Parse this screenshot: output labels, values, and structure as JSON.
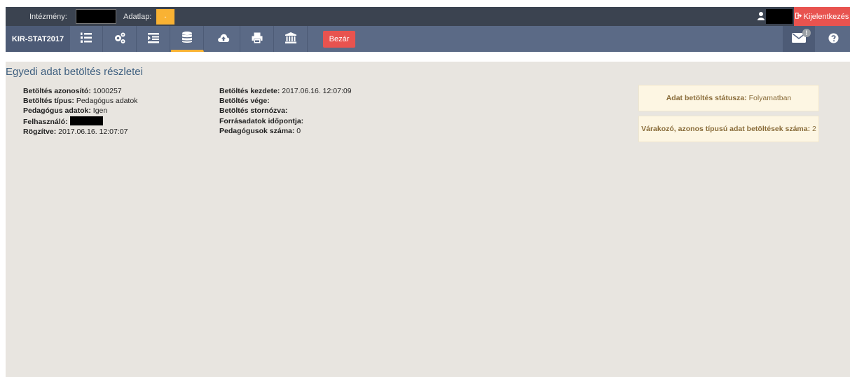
{
  "top": {
    "institution_label": "Intézmény:",
    "form_label": "Adatlap:",
    "form_value": "-",
    "logout_label": "Kijelentkezés",
    "logout_icon": "sign-out-icon",
    "user_icon": "user-icon"
  },
  "nav": {
    "brand": "KIR-STAT2017",
    "buttons": [
      {
        "icon": "list-ordered-icon"
      },
      {
        "icon": "gears-icon"
      },
      {
        "icon": "indent-icon"
      },
      {
        "icon": "database-icon"
      },
      {
        "icon": "cloud-upload-icon"
      },
      {
        "icon": "print-icon"
      },
      {
        "icon": "institution-icon"
      }
    ],
    "close_label": "Bezár",
    "mail_icon": "envelope-icon",
    "mail_badge": "!",
    "help_icon": "question-circle-icon"
  },
  "page": {
    "title": "Egyedi adat betöltés részletei"
  },
  "details": {
    "left": [
      {
        "label": "Betöltés azonosító:",
        "value": "1000257"
      },
      {
        "label": "Betöltés típus:",
        "value": "Pedagógus adatok"
      },
      {
        "label": "Pedagógus adatok:",
        "value": "Igen"
      },
      {
        "label": "Felhasználó:",
        "value": ""
      },
      {
        "label": "Rögzítve:",
        "value": "2017.06.16. 12:07:07"
      }
    ],
    "right": [
      {
        "label": "Betöltés kezdete:",
        "value": "2017.06.16. 12:07:09"
      },
      {
        "label": "Betöltés vége:",
        "value": ""
      },
      {
        "label": "Betöltés stornózva:",
        "value": ""
      },
      {
        "label": "Forrásadatok időpontja:",
        "value": ""
      },
      {
        "label": "Pedagógusok száma:",
        "value": "0"
      }
    ]
  },
  "status": {
    "status_label": "Adat betöltés státusza:",
    "status_value": "Folyamatban",
    "waiting_label": "Várakozó, azonos típusú adat betöltések száma:",
    "waiting_value": "2"
  },
  "colors": {
    "top_bar": "#3b4350",
    "nav_bar": "#5b6a86",
    "accent": "#f9b233",
    "danger": "#e8534f",
    "content_bg": "#e8e5e0",
    "title": "#3e5f7f",
    "status_bg": "#fdf6e3",
    "status_text": "#8a6d3b"
  }
}
